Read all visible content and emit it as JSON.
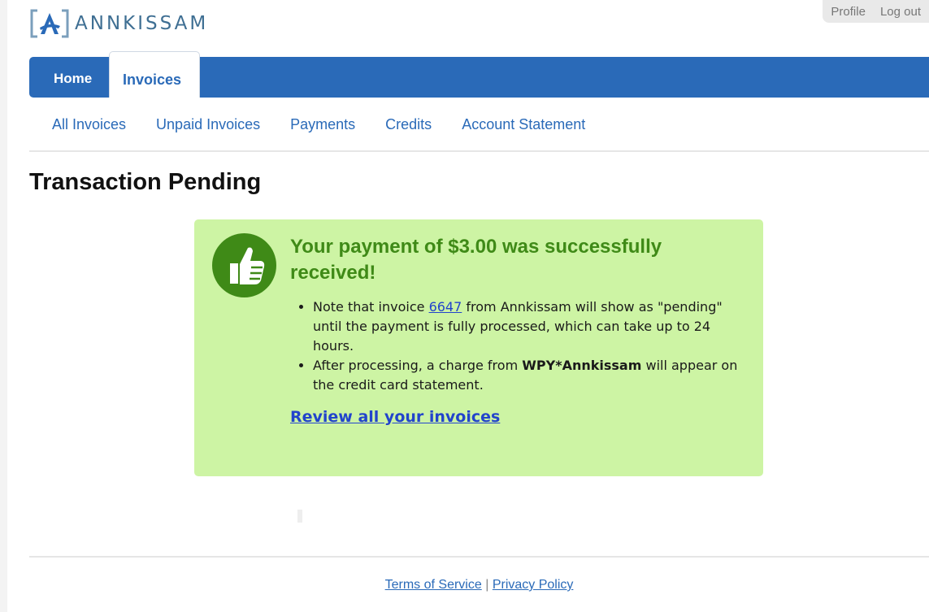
{
  "header": {
    "brand": "ANNKISSAM",
    "profile_label": "Profile",
    "logout_label": "Log out"
  },
  "main_nav": {
    "home_label": "Home",
    "invoices_label": "Invoices"
  },
  "sub_nav": {
    "items": [
      "All Invoices",
      "Unpaid Invoices",
      "Payments",
      "Credits",
      "Account Statement"
    ]
  },
  "page": {
    "title": "Transaction Pending"
  },
  "panel": {
    "heading": "Your payment of $3.00 was successfully received!",
    "note1_prefix": "Note that invoice ",
    "invoice_number": "6647",
    "note1_suffix": " from Annkissam will show as \"pending\" until the payment is fully processed, which can take up to 24 hours.",
    "note2_prefix": "After processing, a charge from ",
    "merchant_descriptor": "WPY*Annkissam",
    "note2_suffix": " will appear on the credit card statement.",
    "review_link": "Review all your invoices"
  },
  "footer": {
    "terms_label": "Terms of Service",
    "separator": "|",
    "privacy_label": "Privacy Policy"
  },
  "colors": {
    "nav_blue": "#2a6ab8",
    "success_bg": "#cdf4a4",
    "success_text": "#3f8a17",
    "link_blue": "#2244cc"
  }
}
